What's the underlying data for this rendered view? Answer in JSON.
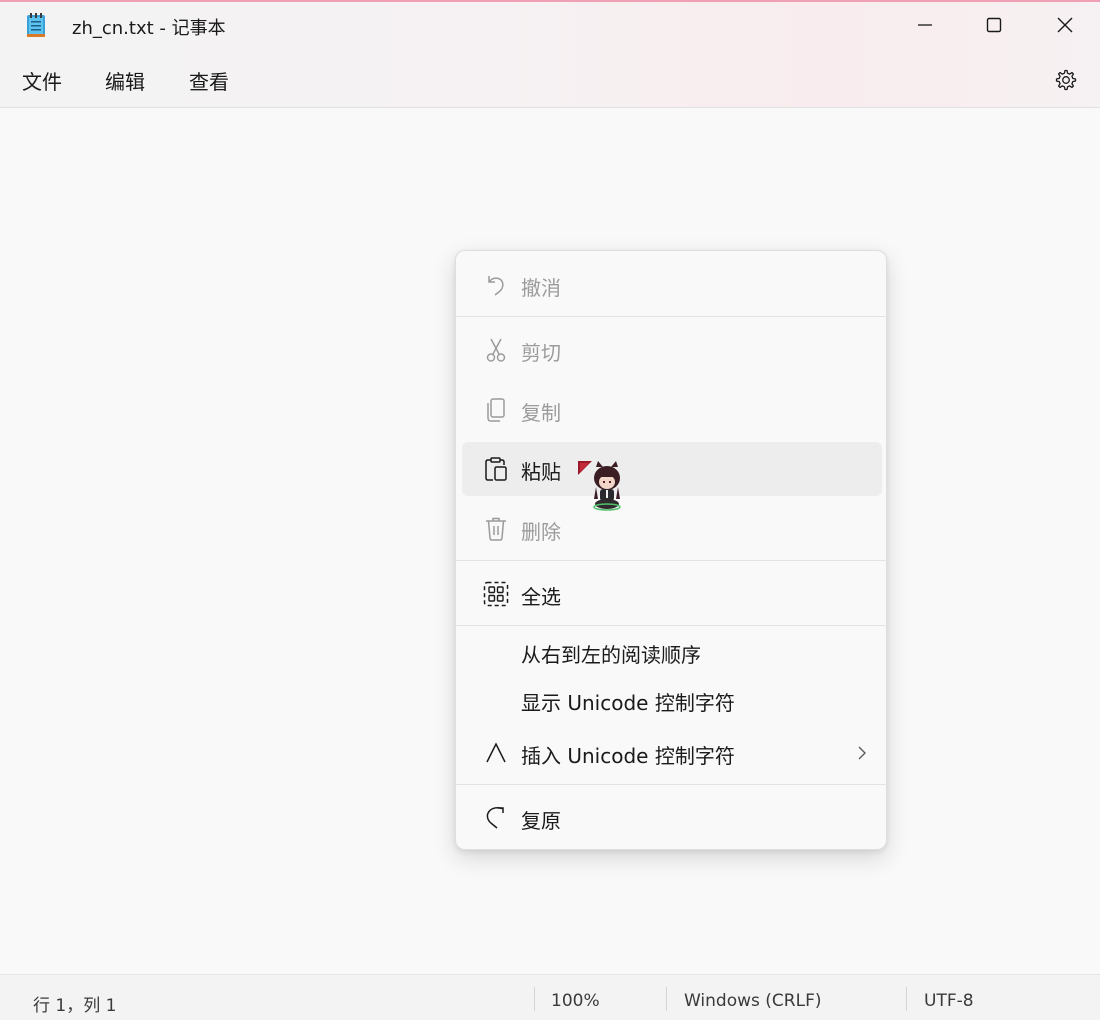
{
  "window": {
    "title": "zh_cn.txt - 记事本",
    "accent_color": "#f0a0b4"
  },
  "menubar": {
    "file": "文件",
    "edit": "编辑",
    "view": "查看",
    "settings_icon": "gear-icon"
  },
  "context_menu": {
    "items": [
      {
        "label": "撤消",
        "icon": "undo-icon",
        "enabled": false
      },
      {
        "label": "剪切",
        "icon": "scissors-icon",
        "enabled": false
      },
      {
        "label": "复制",
        "icon": "copy-icon",
        "enabled": false
      },
      {
        "label": "粘贴",
        "icon": "paste-icon",
        "enabled": true,
        "highlighted": true
      },
      {
        "label": "删除",
        "icon": "trash-icon",
        "enabled": false
      },
      {
        "label": "全选",
        "icon": "select-all-icon",
        "enabled": true
      },
      {
        "label": "从右到左的阅读顺序",
        "enabled": true
      },
      {
        "label": "显示 Unicode 控制字符",
        "enabled": true
      },
      {
        "label": "插入 Unicode 控制字符",
        "icon": "caret-icon",
        "enabled": true,
        "submenu": true
      },
      {
        "label": "复原",
        "icon": "redo-icon",
        "enabled": true
      }
    ]
  },
  "statusbar": {
    "position": "行 1，列 1",
    "zoom": "100%",
    "line_ending": "Windows (CRLF)",
    "encoding": "UTF-8"
  }
}
